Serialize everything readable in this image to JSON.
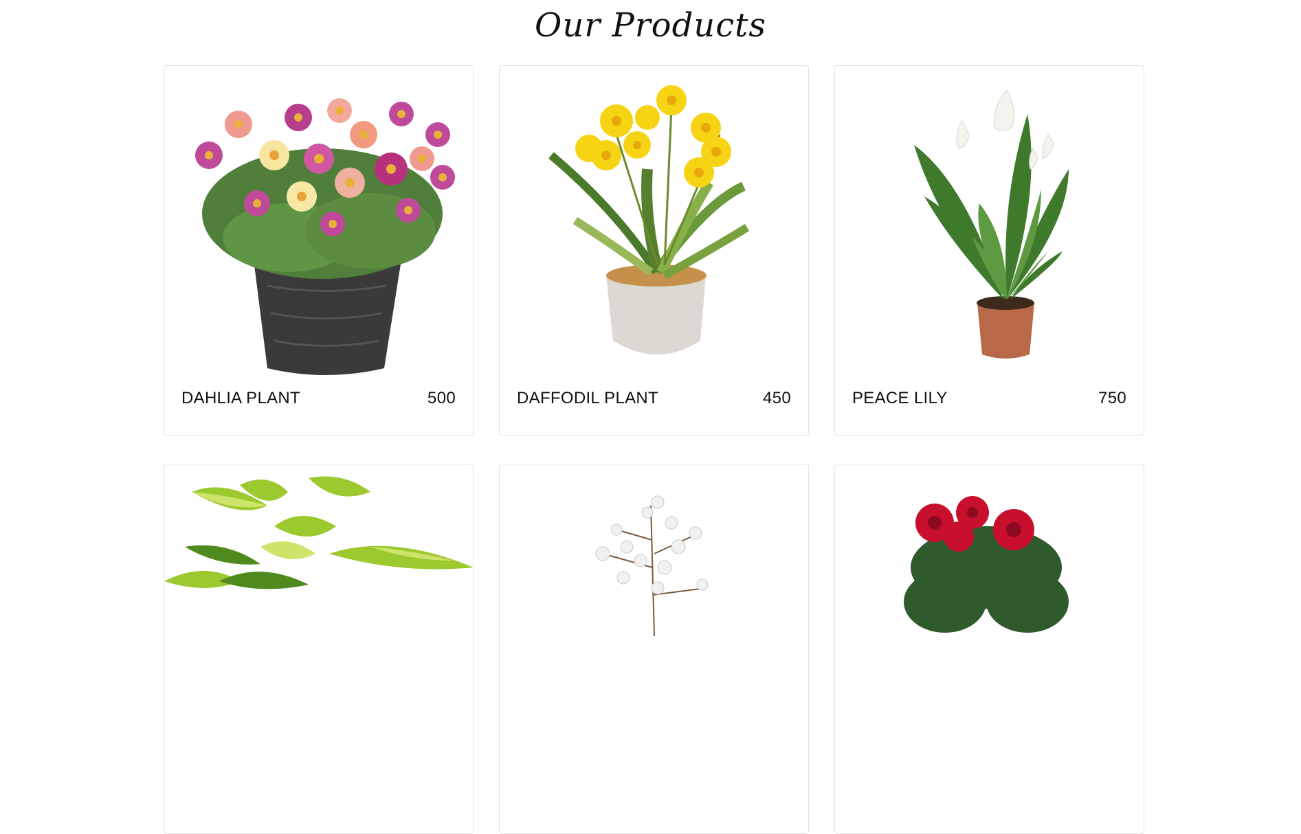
{
  "page": {
    "title": "Our Products"
  },
  "products": [
    {
      "name": "DAHLIA PLANT",
      "price": "500",
      "image": "dahlia-plant-image"
    },
    {
      "name": "DAFFODIL PLANT",
      "price": "450",
      "image": "daffodil-plant-image"
    },
    {
      "name": "PEACE LILY",
      "price": "750",
      "image": "peace-lily-image"
    },
    {
      "name": "",
      "price": "",
      "image": "pothos-plant-image"
    },
    {
      "name": "",
      "price": "",
      "image": "white-blossom-plant-image"
    },
    {
      "name": "",
      "price": "",
      "image": "red-rose-plant-image"
    }
  ]
}
